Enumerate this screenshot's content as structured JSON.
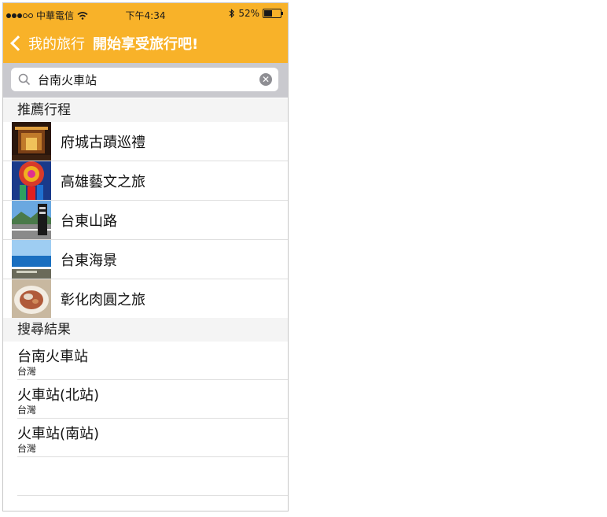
{
  "status_bar": {
    "carrier": "中華電信",
    "time": "下午4:34",
    "battery_percent": "52%",
    "battery_level": 0.52
  },
  "nav": {
    "back_label": "我的旅行",
    "title": "開始享受旅行吧!"
  },
  "search": {
    "value": "台南火車站"
  },
  "recommended": {
    "header": "推薦行程",
    "items": [
      {
        "label": "府城古蹟巡禮"
      },
      {
        "label": "高雄藝文之旅"
      },
      {
        "label": "台東山路"
      },
      {
        "label": "台東海景"
      },
      {
        "label": "彰化肉圓之旅"
      }
    ]
  },
  "results": {
    "header": "搜尋結果",
    "items": [
      {
        "title": "台南火車站",
        "subtitle": "台灣"
      },
      {
        "title": "火車站(北站)",
        "subtitle": "台灣"
      },
      {
        "title": "火車站(南站)",
        "subtitle": "台灣"
      }
    ]
  },
  "colors": {
    "accent": "#f8b229",
    "search_bg": "#c9c9ce",
    "section_bg": "#f4f4f4"
  }
}
